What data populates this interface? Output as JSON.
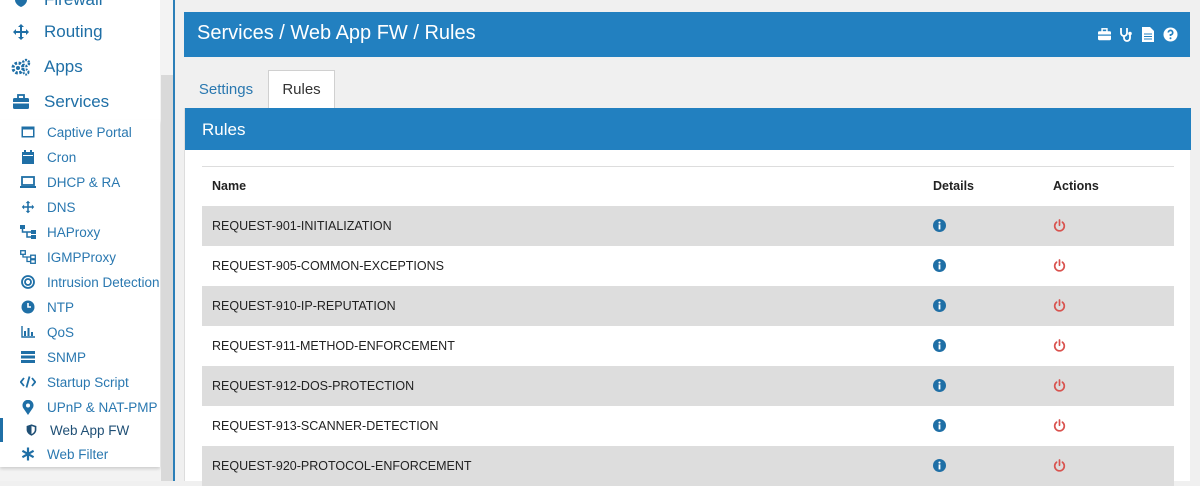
{
  "sidebar": {
    "top_items": [
      {
        "label": "Firewall",
        "icon": "shield-icon"
      },
      {
        "label": "Routing",
        "icon": "arrows-icon"
      },
      {
        "label": "Apps",
        "icon": "cogs-icon"
      },
      {
        "label": "Services",
        "icon": "briefcase-icon"
      }
    ],
    "sub_items": [
      {
        "label": "Captive Portal",
        "icon": "window-icon"
      },
      {
        "label": "Cron",
        "icon": "calendar-icon"
      },
      {
        "label": "DHCP & RA",
        "icon": "laptop-icon"
      },
      {
        "label": "DNS",
        "icon": "arrows-icon"
      },
      {
        "label": "HAProxy",
        "icon": "sitemap-icon"
      },
      {
        "label": "IGMPProxy",
        "icon": "sitemap-outline-icon"
      },
      {
        "label": "Intrusion Detection",
        "icon": "bullseye-icon"
      },
      {
        "label": "NTP",
        "icon": "clock-icon"
      },
      {
        "label": "QoS",
        "icon": "bar-chart-icon"
      },
      {
        "label": "SNMP",
        "icon": "server-icon"
      },
      {
        "label": "Startup Script",
        "icon": "code-icon"
      },
      {
        "label": "UPnP & NAT-PMP",
        "icon": "map-marker-icon"
      },
      {
        "label": "Web App FW",
        "icon": "shield-icon"
      },
      {
        "label": "Web Filter",
        "icon": "asterisk-icon"
      }
    ],
    "active_sub_item": "Web App FW"
  },
  "header": {
    "breadcrumb": "Services / Web App FW / Rules",
    "icons": [
      "briefcase-icon",
      "stethoscope-icon",
      "file-icon",
      "help-icon"
    ]
  },
  "tabs": [
    {
      "label": "Settings",
      "active": false
    },
    {
      "label": "Rules",
      "active": true
    }
  ],
  "panel": {
    "title": "Rules",
    "columns": [
      "Name",
      "Details",
      "Actions"
    ],
    "rows": [
      {
        "name": "REQUEST-901-INITIALIZATION"
      },
      {
        "name": "REQUEST-905-COMMON-EXCEPTIONS"
      },
      {
        "name": "REQUEST-910-IP-REPUTATION"
      },
      {
        "name": "REQUEST-911-METHOD-ENFORCEMENT"
      },
      {
        "name": "REQUEST-912-DOS-PROTECTION"
      },
      {
        "name": "REQUEST-913-SCANNER-DETECTION"
      },
      {
        "name": "REQUEST-920-PROTOCOL-ENFORCEMENT"
      }
    ]
  },
  "colors": {
    "accent": "#2280c0",
    "link": "#2a78b0",
    "power": "#d9534f",
    "info": "#1f6fa6",
    "row_alt": "#dddddd"
  }
}
